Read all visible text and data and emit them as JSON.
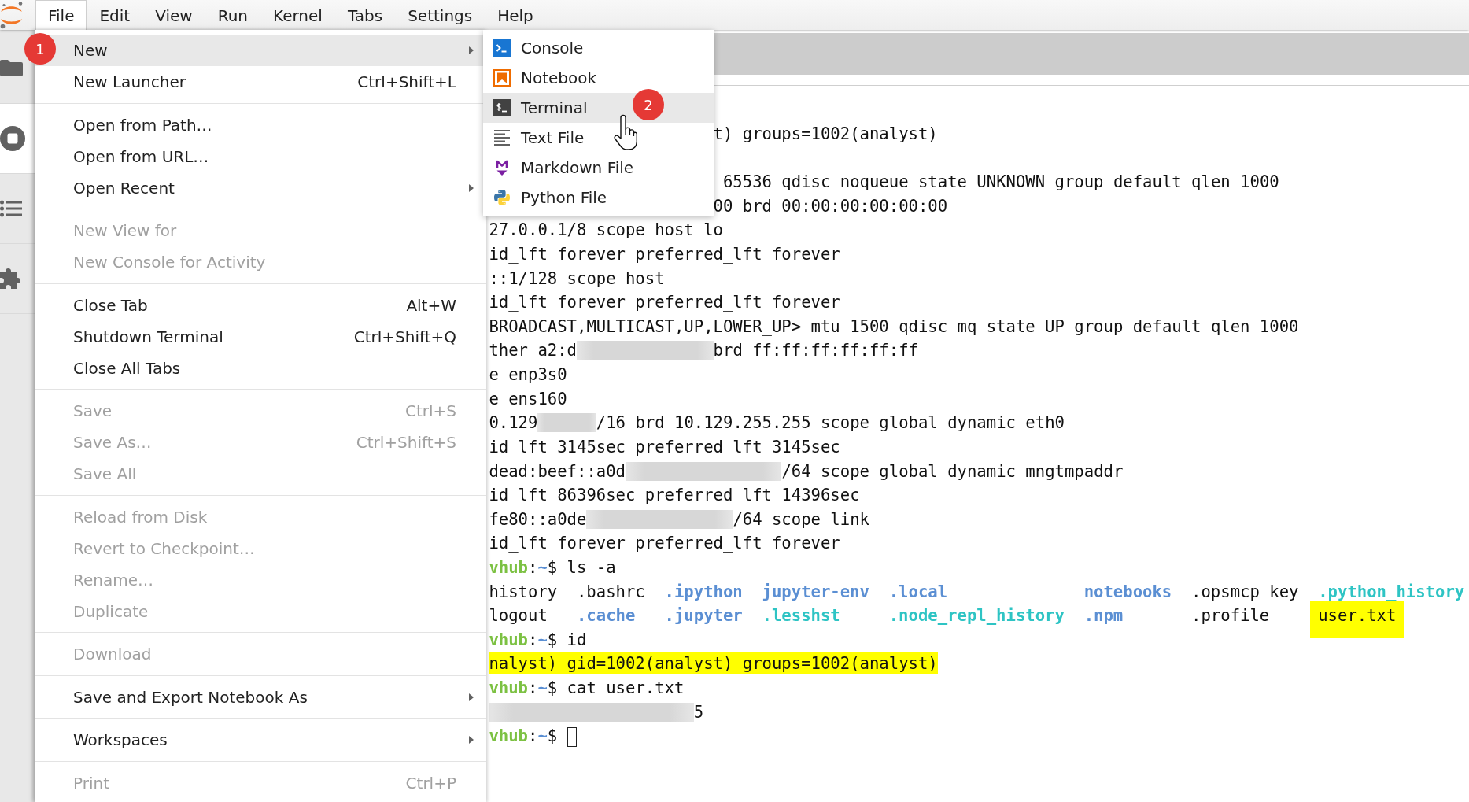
{
  "menubar": {
    "items": [
      {
        "label": "File",
        "selected": true
      },
      {
        "label": "Edit",
        "selected": false
      },
      {
        "label": "View",
        "selected": false
      },
      {
        "label": "Run",
        "selected": false
      },
      {
        "label": "Kernel",
        "selected": false
      },
      {
        "label": "Tabs",
        "selected": false
      },
      {
        "label": "Settings",
        "selected": false
      },
      {
        "label": "Help",
        "selected": false
      }
    ]
  },
  "sidebar": {
    "tabs": [
      {
        "selected": false
      },
      {
        "selected": true
      },
      {
        "selected": false
      },
      {
        "selected": false
      }
    ]
  },
  "file_menu": {
    "groups": [
      {
        "items": [
          {
            "label": "New",
            "disabled": false,
            "submenu": true,
            "selected": true,
            "badge": "1"
          },
          {
            "label": "New Launcher",
            "shortcut": "Ctrl+Shift+L",
            "disabled": false,
            "submenu": false,
            "selected": false
          }
        ]
      },
      {
        "items": [
          {
            "label": "Open from Path…",
            "disabled": false,
            "submenu": false,
            "selected": false
          },
          {
            "label": "Open from URL…",
            "disabled": false,
            "submenu": false,
            "selected": false
          },
          {
            "label": "Open Recent",
            "disabled": false,
            "submenu": true,
            "selected": false
          }
        ]
      },
      {
        "items": [
          {
            "label": "New View for",
            "disabled": true,
            "submenu": false,
            "selected": false
          },
          {
            "label": "New Console for Activity",
            "disabled": true,
            "submenu": false,
            "selected": false
          }
        ]
      },
      {
        "items": [
          {
            "label": "Close Tab",
            "shortcut": "Alt+W",
            "disabled": false,
            "submenu": false,
            "selected": false
          },
          {
            "label": "Shutdown Terminal",
            "shortcut": "Ctrl+Shift+Q",
            "disabled": false,
            "submenu": false,
            "selected": false
          },
          {
            "label": "Close All Tabs",
            "disabled": false,
            "submenu": false,
            "selected": false
          }
        ]
      },
      {
        "items": [
          {
            "label": "Save",
            "shortcut": "Ctrl+S",
            "disabled": true,
            "submenu": false,
            "selected": false
          },
          {
            "label": "Save As…",
            "shortcut": "Ctrl+Shift+S",
            "disabled": true,
            "submenu": false,
            "selected": false
          },
          {
            "label": "Save All",
            "disabled": true,
            "submenu": false,
            "selected": false
          }
        ]
      },
      {
        "items": [
          {
            "label": "Reload from Disk",
            "disabled": true,
            "submenu": false,
            "selected": false
          },
          {
            "label": "Revert to Checkpoint…",
            "disabled": true,
            "submenu": false,
            "selected": false
          },
          {
            "label": "Rename…",
            "disabled": true,
            "submenu": false,
            "selected": false
          },
          {
            "label": "Duplicate",
            "disabled": true,
            "submenu": false,
            "selected": false
          }
        ]
      },
      {
        "items": [
          {
            "label": "Download",
            "disabled": true,
            "submenu": false,
            "selected": false
          }
        ]
      },
      {
        "items": [
          {
            "label": "Save and Export Notebook As",
            "disabled": false,
            "submenu": true,
            "selected": false
          }
        ]
      },
      {
        "items": [
          {
            "label": "Workspaces",
            "disabled": false,
            "submenu": true,
            "selected": false
          }
        ]
      },
      {
        "items": [
          {
            "label": "Print",
            "shortcut": "Ctrl+P",
            "disabled": true,
            "submenu": false,
            "selected": false
          }
        ]
      }
    ]
  },
  "new_submenu": {
    "items": [
      {
        "label": "Console",
        "selected": false
      },
      {
        "label": "Notebook",
        "selected": false
      },
      {
        "label": "Terminal",
        "selected": true,
        "badge": "2"
      },
      {
        "label": "Text File",
        "selected": false
      },
      {
        "label": "Markdown File",
        "selected": false
      },
      {
        "label": "Python File",
        "selected": false
      }
    ]
  },
  "terminal": {
    "lines": [
      {
        "kind": "output",
        "text": "                       t) groups=1002(analyst)",
        "highlighted": false,
        "redacted": false
      },
      {
        "kind": "blank"
      },
      {
        "kind": "output",
        "text": "                        65536 qdisc noqueue state UNKNOWN group default qlen 1000",
        "highlighted": false,
        "redacted": false
      },
      {
        "kind": "output",
        "text": "                       00 brd 00:00:00:00:00:00",
        "highlighted": false,
        "redacted": false
      },
      {
        "kind": "output",
        "text": "27.0.0.1/8 scope host lo",
        "highlighted": false,
        "redacted": false
      },
      {
        "kind": "output",
        "text": "id_lft forever preferred_lft forever",
        "highlighted": false,
        "redacted": false
      },
      {
        "kind": "output",
        "text": "::1/128 scope host",
        "highlighted": false,
        "redacted": false
      },
      {
        "kind": "output",
        "text": "id_lft forever preferred_lft forever",
        "highlighted": false,
        "redacted": false
      },
      {
        "kind": "output",
        "text": "BROADCAST,MULTICAST,UP,LOWER_UP> mtu 1500 qdisc mq state UP group default qlen 1000",
        "highlighted": false,
        "redacted": false
      },
      {
        "kind": "output",
        "text": "ther a2:d              brd ff:ff:ff:ff:ff:ff",
        "highlighted": false,
        "redacted": true
      },
      {
        "kind": "output",
        "text": "e enp3s0",
        "highlighted": false,
        "redacted": false
      },
      {
        "kind": "output",
        "text": "e ens160",
        "highlighted": false,
        "redacted": false
      },
      {
        "kind": "output",
        "text": "0.129      /16 brd 10.129.255.255 scope global dynamic eth0",
        "highlighted": false,
        "redacted": true
      },
      {
        "kind": "output",
        "text": "id_lft 3145sec preferred_lft 3145sec",
        "highlighted": false,
        "redacted": false
      },
      {
        "kind": "output",
        "text": "dead:beef::a0d                /64 scope global dynamic mngtmpaddr",
        "highlighted": false,
        "redacted": true
      },
      {
        "kind": "output",
        "text": "id_lft 86396sec preferred_lft 14396sec",
        "highlighted": false,
        "redacted": false
      },
      {
        "kind": "output",
        "text": "fe80::a0de               /64 scope link",
        "highlighted": false,
        "redacted": true
      },
      {
        "kind": "output",
        "text": "id_lft forever preferred_lft forever",
        "highlighted": false,
        "redacted": false
      },
      {
        "kind": "prompt",
        "host": "vhub",
        "separator": ":",
        "path": "~",
        "symbol": "$",
        "command": "ls -a",
        "cursor": false
      },
      {
        "kind": "listing",
        "rows": [
          [
            {
              "name": "history",
              "kind": "file",
              "highlighted": false
            },
            {
              "name": ".bashrc",
              "kind": "file",
              "highlighted": false
            },
            {
              "name": ".ipython",
              "kind": "dir",
              "highlighted": false
            },
            {
              "name": "jupyter-env",
              "kind": "dir",
              "highlighted": false
            },
            {
              "name": ".local",
              "kind": "dir",
              "highlighted": false
            },
            {
              "name": "notebooks",
              "kind": "dir",
              "highlighted": false
            },
            {
              "name": ".opsmcp_key",
              "kind": "file",
              "highlighted": false
            },
            {
              "name": ".python_history",
              "kind": "link",
              "highlighted": false
            }
          ],
          [
            {
              "name": "logout",
              "kind": "file",
              "highlighted": false
            },
            {
              "name": ".cache",
              "kind": "dir",
              "highlighted": false
            },
            {
              "name": ".jupyter",
              "kind": "dir",
              "highlighted": false
            },
            {
              "name": ".lesshst",
              "kind": "link",
              "highlighted": false
            },
            {
              "name": ".node_repl_history",
              "kind": "link",
              "highlighted": false
            },
            {
              "name": ".npm",
              "kind": "dir",
              "highlighted": false
            },
            {
              "name": ".profile",
              "kind": "file",
              "highlighted": false
            },
            {
              "name": "user.txt",
              "kind": "file",
              "highlighted": true
            }
          ]
        ]
      },
      {
        "kind": "prompt",
        "host": "vhub",
        "separator": ":",
        "path": "~",
        "symbol": "$",
        "command": "id",
        "cursor": false
      },
      {
        "kind": "output",
        "text": "nalyst) gid=1002(analyst) groups=1002(analyst)",
        "highlighted": true,
        "redacted": false
      },
      {
        "kind": "prompt",
        "host": "vhub",
        "separator": ":",
        "path": "~",
        "symbol": "$",
        "command": "cat user.txt",
        "cursor": false
      },
      {
        "kind": "output",
        "text": "                     5",
        "highlighted": false,
        "redacted": true
      },
      {
        "kind": "prompt",
        "host": "vhub",
        "separator": ":",
        "path": "~",
        "symbol": "$",
        "cursor": true
      }
    ]
  }
}
